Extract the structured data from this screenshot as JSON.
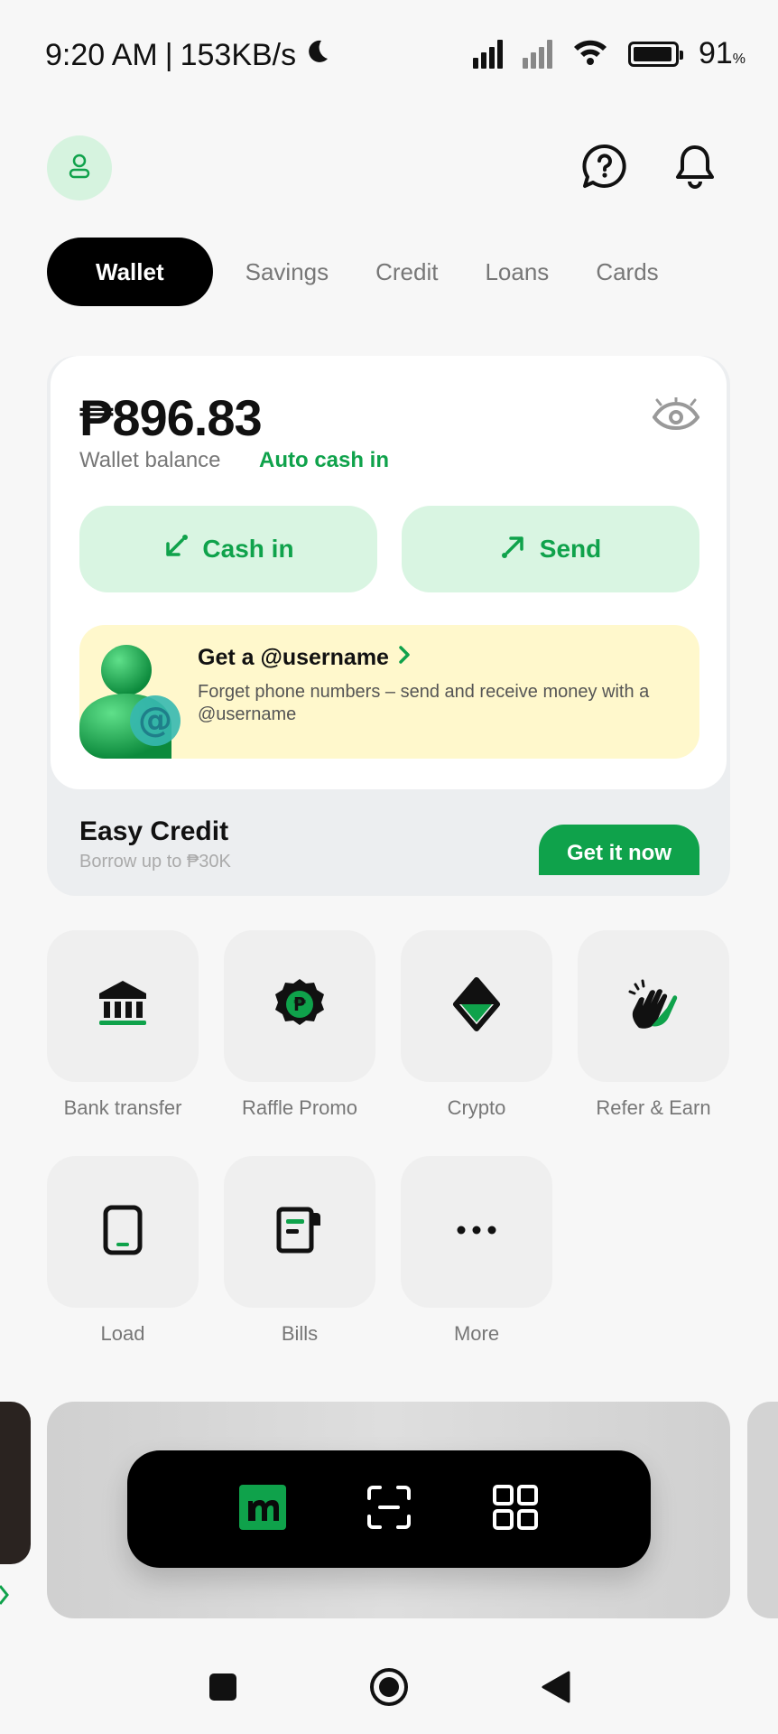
{
  "status_bar": {
    "time": "9:20 AM",
    "separator": "|",
    "network_speed": "153KB/s",
    "battery_level": "91",
    "battery_unit": "%"
  },
  "header": {
    "avatar_icon": "user-icon",
    "help_icon": "help-icon",
    "notification_icon": "bell-icon"
  },
  "tabs": [
    {
      "label": "Wallet",
      "active": true
    },
    {
      "label": "Savings",
      "active": false
    },
    {
      "label": "Credit",
      "active": false
    },
    {
      "label": "Loans",
      "active": false
    },
    {
      "label": "Cards",
      "active": false
    }
  ],
  "wallet": {
    "balance": "₱896.83",
    "balance_label": "Wallet balance",
    "auto_cash_in": "Auto cash in",
    "cash_in_label": "Cash in",
    "send_label": "Send"
  },
  "promo": {
    "title": "Get a @username",
    "description": "Forget phone numbers – send and receive money with a @username"
  },
  "easy_credit": {
    "title": "Easy Credit",
    "subtitle": "Borrow up to ₱30K",
    "button": "Get it now"
  },
  "quick_actions": [
    {
      "label": "Bank transfer",
      "icon": "bank-icon"
    },
    {
      "label": "Raffle Promo",
      "icon": "raffle-badge-icon"
    },
    {
      "label": "Crypto",
      "icon": "crypto-diamond-icon"
    },
    {
      "label": "Refer & Earn",
      "icon": "clapping-hands-icon"
    },
    {
      "label": "Load",
      "icon": "phone-load-icon"
    },
    {
      "label": "Bills",
      "icon": "bills-icon"
    },
    {
      "label": "More",
      "icon": "more-dots-icon"
    }
  ],
  "bottom_nav": [
    {
      "icon": "maya-logo-icon"
    },
    {
      "icon": "scan-icon"
    },
    {
      "icon": "grid-apps-icon"
    }
  ],
  "colors": {
    "accent": "#0fa24b",
    "accent_light": "#d9f5e2",
    "promo_bg": "#fff8cc",
    "dark": "#000000"
  }
}
